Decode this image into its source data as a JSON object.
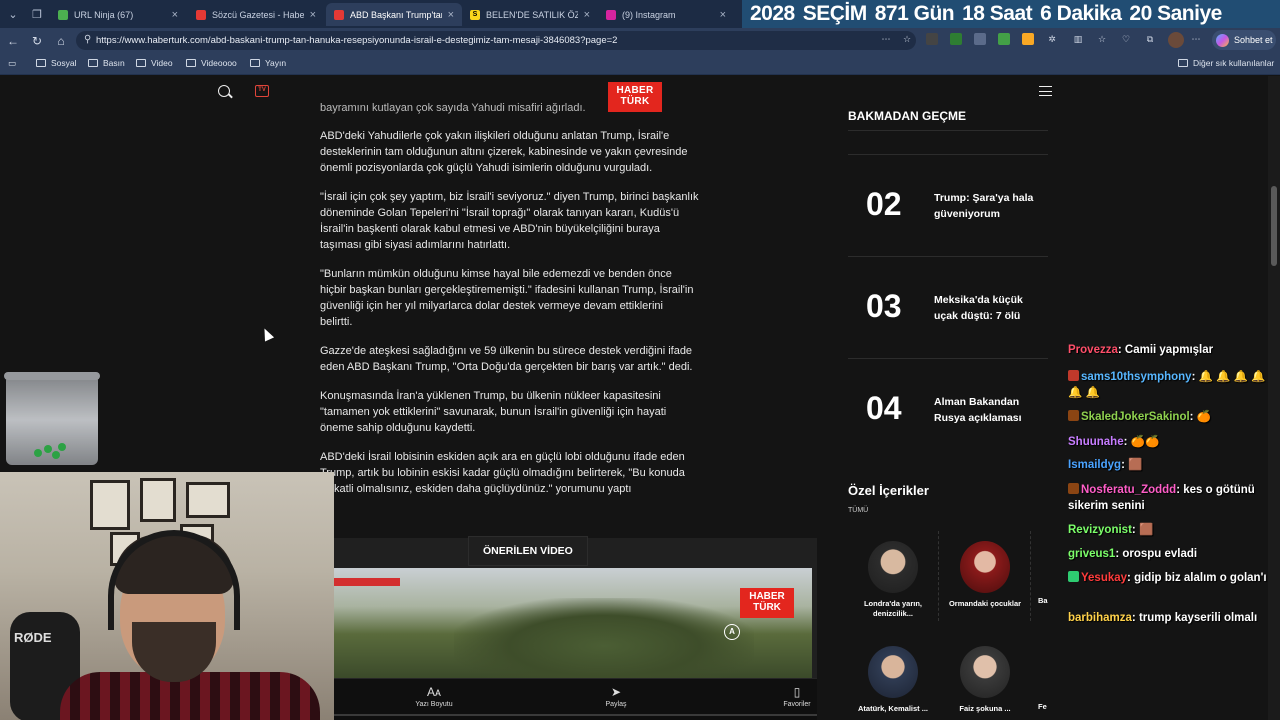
{
  "browser": {
    "tabs": [
      {
        "title": "URL Ninja (67)",
        "favicon_color": "#4caf50"
      },
      {
        "title": "Sözcü Gazetesi - Haberler, S",
        "favicon_color": "#e53935"
      },
      {
        "title": "ABD Başkanı Trump'tan Ha",
        "favicon_color": "#e53935",
        "active": true
      },
      {
        "title": "BELEN'DE SATILIK ÖZEL TA",
        "favicon_color": "#f9d71c"
      },
      {
        "title": "(9) Instagram",
        "favicon_color": "#d6249f"
      }
    ],
    "countdown": {
      "year": "2028",
      "label": "SEÇİM",
      "days": "871 Gün",
      "hours": "18 Saat",
      "minutes": "6 Dakika",
      "seconds": "20 Saniye"
    },
    "url": "https://www.haberturk.com/abd-baskani-trump-tan-hanuka-resepsiyonunda-israil-e-destegimiz-tam-mesaji-3846083?page=2",
    "copilot_label": "Sohbet et",
    "bookmarks": [
      "Sosyal",
      "Basın",
      "Video",
      "Videoooo",
      "Yayın"
    ],
    "other_bookmarks": "Diğer sık kullanılanlar"
  },
  "site": {
    "logo_line1": "HABER",
    "logo_line2": "TÜRK",
    "tv_label": "TV"
  },
  "article": {
    "cut_top": "bayramını kutlayan çok sayıda Yahudi misafiri ağırladı.",
    "paragraphs": [
      [
        "ABD'deki Yahudilerle çok yakın ilişkileri olduğunu anlatan Trump, İsrail'e",
        "desteklerinin tam olduğunun altını çizerek, kabinesinde ve yakın çevresinde",
        "önemli pozisyonlarda çok güçlü Yahudi isimlerin olduğunu vurguladı."
      ],
      [
        "\"İsrail için çok şey yaptım, biz İsrail'i seviyoruz.\" diyen Trump, birinci başkanlık",
        "döneminde Golan Tepeleri'ni \"İsrail toprağı\" olarak tanıyan kararı, Kudüs'ü",
        "İsrail'in başkenti olarak kabul etmesi ve ABD'nin büyükelçiliğini buraya",
        "taşıması gibi siyasi adımlarını hatırlattı."
      ],
      [
        "\"Bunların mümkün olduğunu kimse hayal bile edemezdi ve benden önce",
        "hiçbir başkan bunları gerçekleştirememişti.\" ifadesini kullanan Trump, İsrail'in",
        "güvenliği için her yıl milyarlarca dolar destek vermeye devam ettiklerini",
        "belirtti."
      ],
      [
        "Gazze'de ateşkesi sağladığını ve 59 ülkenin bu sürece destek verdiğini ifade",
        "eden ABD Başkanı Trump, \"Orta Doğu'da gerçekten bir barış var artık.\" dedi."
      ],
      [
        "Konuşmasında İran'a yüklenen Trump, bu ülkenin nükleer kapasitesini",
        "\"tamamen yok ettiklerini\" savunarak, bunun İsrail'in güvenliği için hayati",
        "öneme sahip olduğunu kaydetti."
      ],
      [
        "ABD'deki İsrail lobisinin eskiden açık ara en güçlü lobi olduğunu ifade eden",
        "Trump, artık bu lobinin eskisi kadar güçlü olmadığını belirterek, \"Bu konuda",
        "dikkatli olmalısınız, eskiden daha güçlüydünüz.\" yorumunu yaptı"
      ]
    ]
  },
  "recommended_video": {
    "label": "ÖNERİLEN VİDEO"
  },
  "bottom_bar": [
    {
      "label": "Yazı Boyutu",
      "icon": "font-size-icon",
      "glyph": "Aᴀ"
    },
    {
      "label": "Paylaş",
      "icon": "share-icon",
      "glyph": "➤"
    },
    {
      "label": "Favoriler",
      "icon": "bookmark-icon",
      "glyph": "▯"
    }
  ],
  "sidebar": {
    "title": "BAKMADAN GEÇME",
    "items": [
      {
        "rank": "02",
        "title": "Trump: Şara'ya hala güveniyorum"
      },
      {
        "rank": "03",
        "title": "Meksika'da küçük uçak düştü: 7 ölü"
      },
      {
        "rank": "04",
        "title": "Alman Bakandan Rusya açıklaması"
      }
    ],
    "special_title": "Özel İçerikler",
    "all_label": "TÜMÜ",
    "people": [
      {
        "caption": "Londra'da yarın, denizcilik..."
      },
      {
        "caption": "Ormandaki çocuklar"
      },
      {
        "caption": "Ba"
      },
      {
        "caption": "Atatürk, Kemalist ..."
      },
      {
        "caption": "Faiz şokuna ..."
      },
      {
        "caption": "Fe"
      }
    ]
  },
  "webcam": {
    "mic_brand": "RØDE"
  },
  "chat": [
    {
      "user": "Provezza",
      "color": "#ff4f6a",
      "text": "Camii yapmışlar",
      "badge": ""
    },
    {
      "user": "sams10thsymphony",
      "color": "#58b7ff",
      "text": "🔔 🔔 🔔 🔔 🔔 🔔",
      "badge": "#c0392b"
    },
    {
      "user": "SkaledJokerSakinol",
      "color": "#8fd14f",
      "text": "🍊",
      "badge": "#8b4513"
    },
    {
      "user": "Shuunahe",
      "color": "#c77dff",
      "text": "🍊🍊",
      "badge": ""
    },
    {
      "user": "Ismaildyg",
      "color": "#4aa3ff",
      "text": "🟫",
      "badge": ""
    },
    {
      "user": "Nosferatu_Zoddd",
      "color": "#ff5ec8",
      "text": "kes o götünü sikerim senini",
      "badge": "#8b4513"
    },
    {
      "user": "Revizyonist",
      "color": "#7cff6a",
      "text": "🟫",
      "badge": ""
    },
    {
      "user": "griveus1",
      "color": "#7cff6a",
      "text": "orospu evladi",
      "badge": ""
    },
    {
      "user": "Yesukay",
      "color": "#ff3c3c",
      "text": "gidip biz alalım o golan'ı",
      "badge": "#2ecc71"
    },
    {
      "user": "barbihamza",
      "color": "#ffd24a",
      "text": "trump kayserili olmalı",
      "badge": ""
    }
  ],
  "colors": {
    "brand_red": "#e3261e",
    "page_bg": "#141414",
    "browser_bg": "#2d3e5c"
  }
}
